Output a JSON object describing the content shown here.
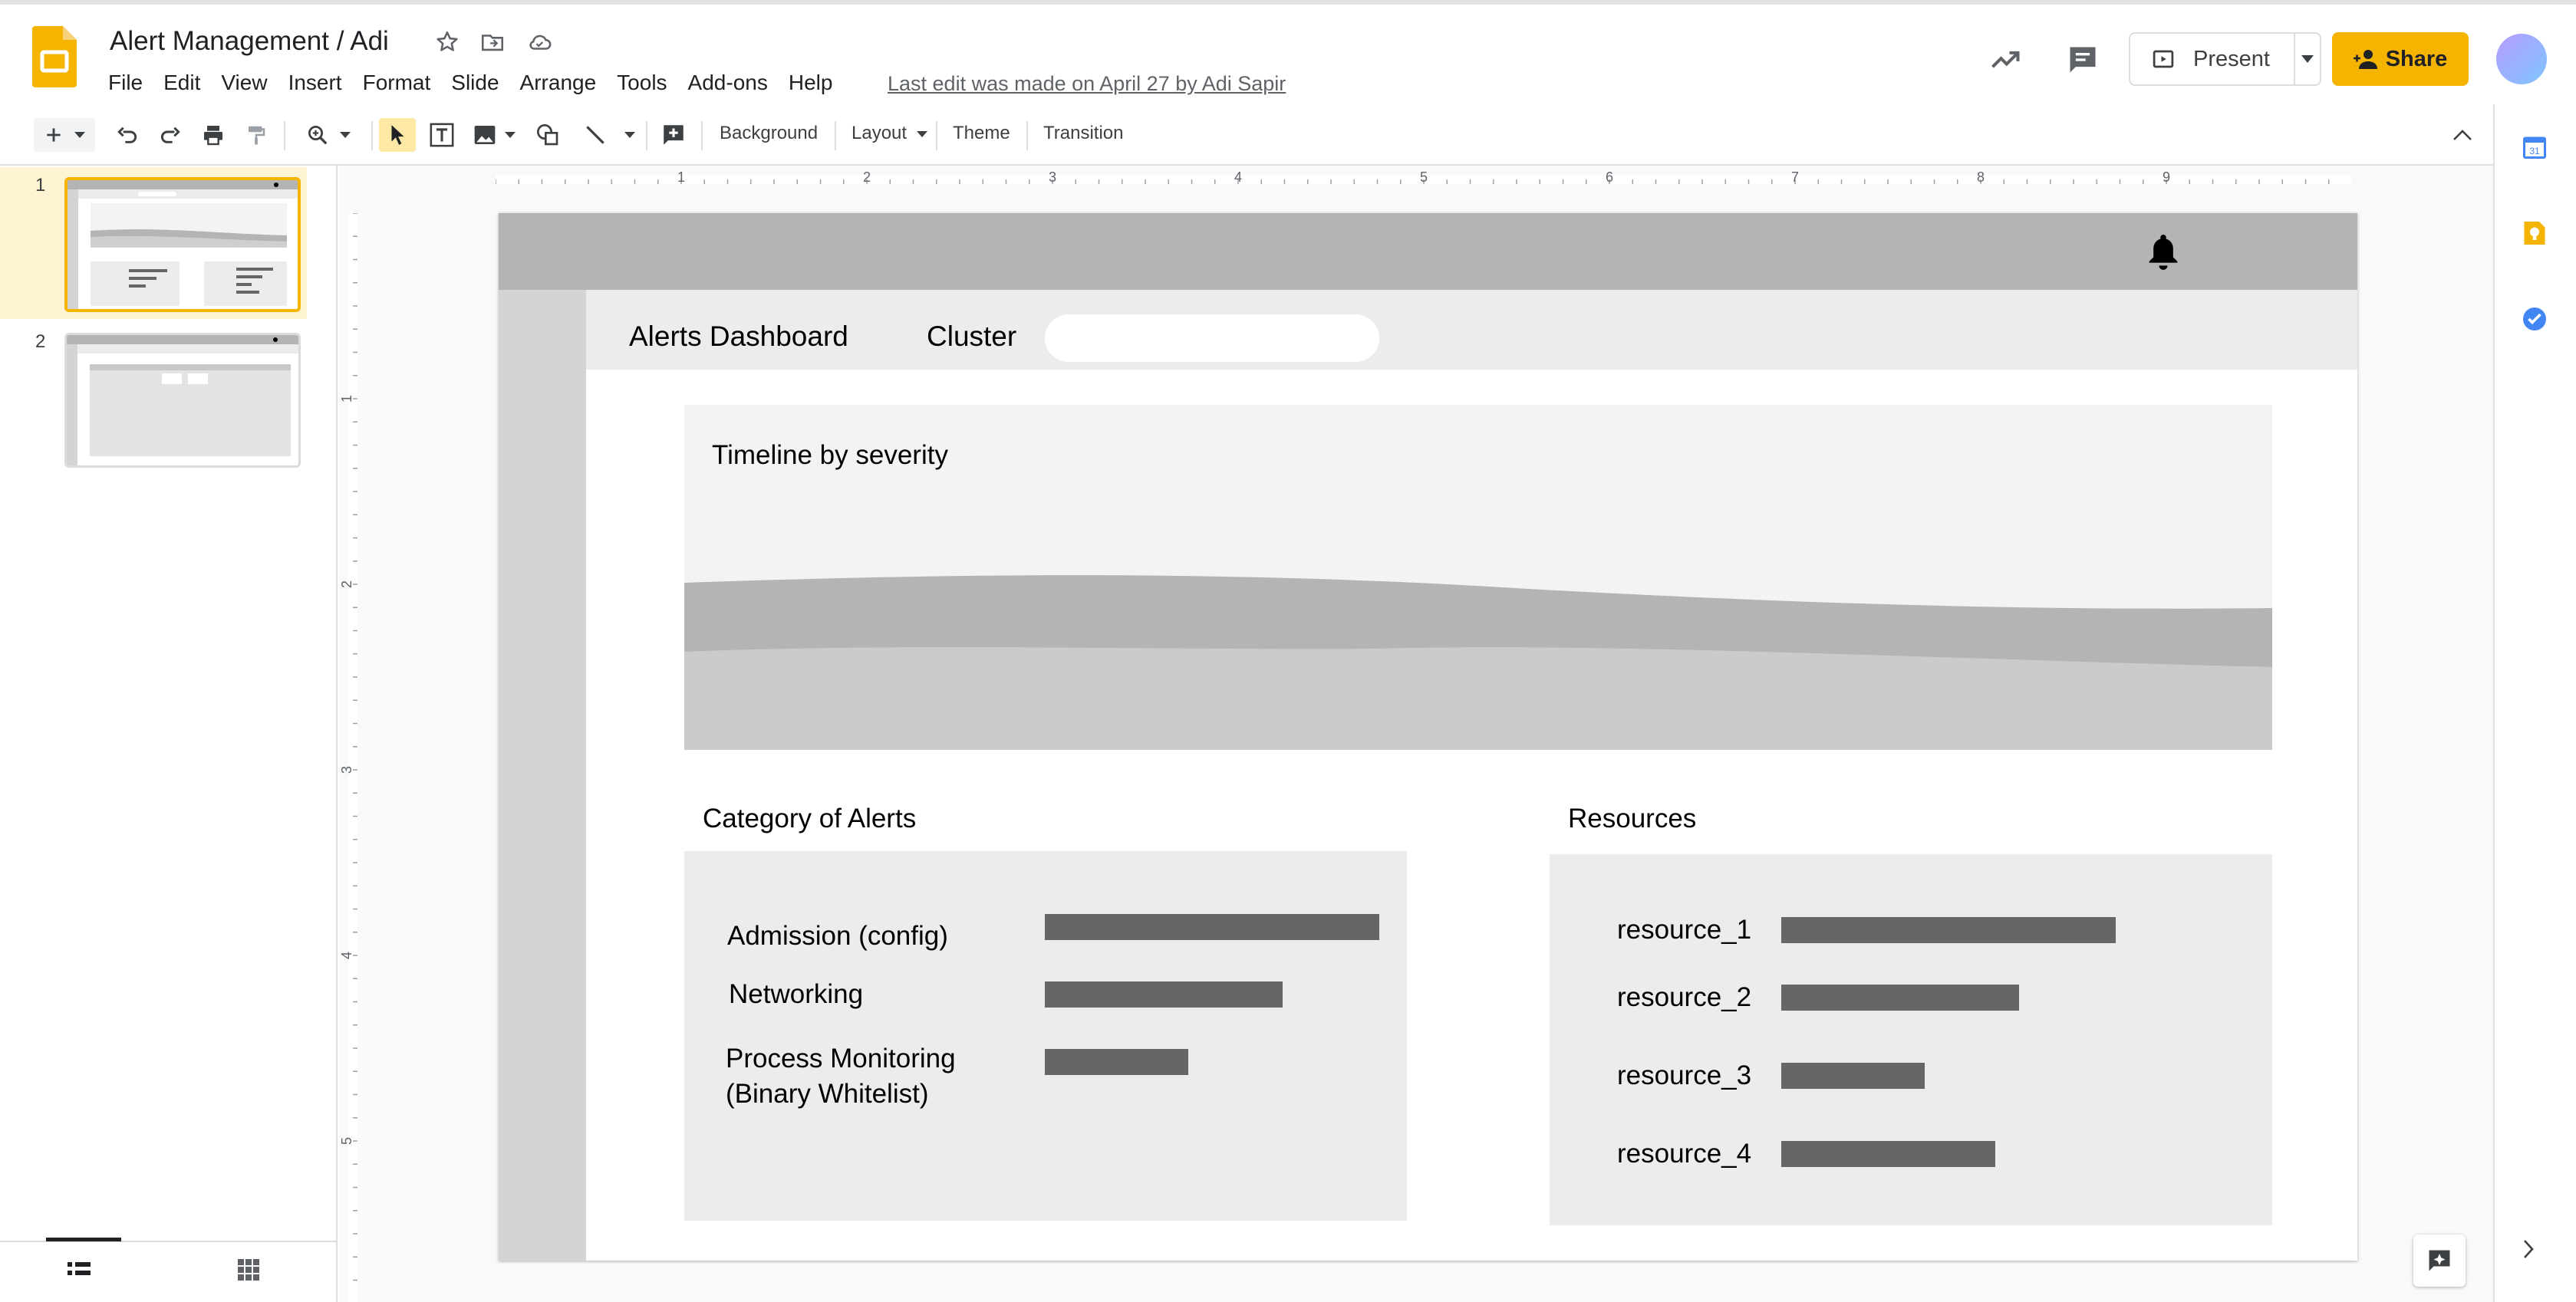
{
  "app": {
    "title": "Alert Management / Adi",
    "menu": [
      "File",
      "Edit",
      "View",
      "Insert",
      "Format",
      "Slide",
      "Arrange",
      "Tools",
      "Add-ons",
      "Help"
    ],
    "last_edit": "Last edit was made on April 27 by Adi Sapir",
    "present_label": "Present",
    "share_label": "Share"
  },
  "toolbar": {
    "background_label": "Background",
    "layout_label": "Layout",
    "theme_label": "Theme",
    "transition_label": "Transition"
  },
  "filmstrip": {
    "slides": [
      {
        "number": "1"
      },
      {
        "number": "2"
      }
    ]
  },
  "rulers": {
    "horizontal": [
      "1",
      "2",
      "3",
      "4",
      "5",
      "6",
      "7",
      "8",
      "9"
    ],
    "vertical": [
      "1",
      "2",
      "3",
      "4",
      "5"
    ]
  },
  "slide": {
    "dashboard_title": "Alerts Dashboard",
    "cluster_label": "Cluster",
    "timeline_title": "Timeline by severity",
    "category_title": "Category of Alerts",
    "categories": [
      {
        "label": "Admission (config)",
        "value": 1.0
      },
      {
        "label": "Networking",
        "value": 0.71
      },
      {
        "label": "Process Monitoring\n(Binary Whitelist)",
        "value": 0.43
      }
    ],
    "resources_title": "Resources",
    "resources": [
      {
        "label": "resource_1",
        "value": 1.0
      },
      {
        "label": "resource_2",
        "value": 0.71
      },
      {
        "label": "resource_3",
        "value": 0.43
      },
      {
        "label": "resource_4",
        "value": 0.64
      }
    ]
  },
  "colors": {
    "accent": "#f4b400",
    "bar": "#666666",
    "topbar": "#b4b4b4"
  }
}
